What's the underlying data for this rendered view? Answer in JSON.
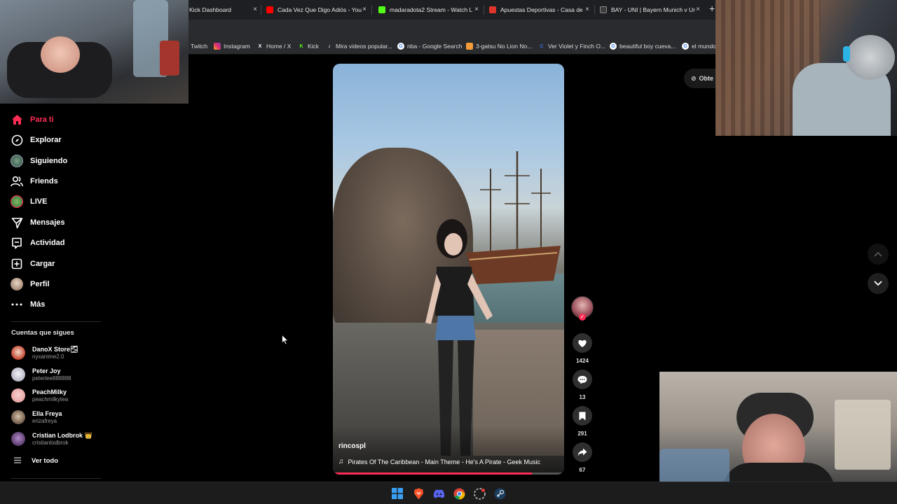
{
  "browser": {
    "tabs": [
      {
        "title": "Kick Dashboard",
        "favicon_color": "#1e1f22"
      },
      {
        "title": "Cada Vez Que Digo Adiós - You",
        "favicon_color": "#ff0000"
      },
      {
        "title": "madaradota2 Stream - Watch L",
        "favicon_color": "#53fc18"
      },
      {
        "title": "Apuestas Deportivas - Casa de",
        "favicon_color": "#e0352b"
      },
      {
        "title": "BAY - UNI | Bayern Munich v Ur",
        "favicon_color": "#3d3d3d"
      }
    ],
    "close_glyph": "×",
    "new_tab_glyph": "+",
    "bookmarks": [
      {
        "label": "Twitch",
        "icon": "twitch-icon",
        "color": "#9146ff",
        "glyph": ""
      },
      {
        "label": "Instagram",
        "icon": "instagram-icon",
        "color": "#e1306c",
        "glyph": ""
      },
      {
        "label": "Home / X",
        "icon": "x-icon",
        "color": "#000000",
        "glyph": "X"
      },
      {
        "label": "Kick",
        "icon": "kick-icon",
        "color": "#53fc18",
        "glyph": "K"
      },
      {
        "label": "Mira videos popular...",
        "icon": "tiktok-icon",
        "color": "#000000",
        "glyph": "♪"
      },
      {
        "label": "nba - Google Search",
        "icon": "google-icon",
        "color": "#ffffff",
        "glyph": "G"
      },
      {
        "label": "3-gatsu No Lion No...",
        "icon": "bookmark-icon",
        "color": "#f29b38",
        "glyph": ""
      },
      {
        "label": "Ver Violet y Finch O...",
        "icon": "link-icon",
        "color": "#3b6de3",
        "glyph": "C"
      },
      {
        "label": "beautiful boy cueva...",
        "icon": "google-icon",
        "color": "#ffffff",
        "glyph": "G"
      },
      {
        "label": "el mundo",
        "icon": "google-icon",
        "color": "#ffffff",
        "glyph": "G"
      }
    ]
  },
  "sidebar": {
    "nav": [
      {
        "label": "Para ti",
        "icon": "home-icon",
        "active": true
      },
      {
        "label": "Explorar",
        "icon": "compass-icon"
      },
      {
        "label": "Siguiendo",
        "icon": "following-avatar-icon"
      },
      {
        "label": "Friends",
        "icon": "friends-icon"
      },
      {
        "label": "LIVE",
        "icon": "live-icon"
      },
      {
        "label": "Mensajes",
        "icon": "send-icon"
      },
      {
        "label": "Actividad",
        "icon": "activity-icon"
      },
      {
        "label": "Cargar",
        "icon": "upload-icon"
      },
      {
        "label": "Perfil",
        "icon": "profile-icon"
      },
      {
        "label": "Más",
        "icon": "more-icon"
      }
    ],
    "following_title": "Cuentas que sigues",
    "following": [
      {
        "name": "DanoX Store🌫",
        "handle": "nyxanime2.0",
        "color": "#c2452f"
      },
      {
        "name": "Peter Joy",
        "handle": "peterlee888888",
        "color": "#d7d7e3"
      },
      {
        "name": "PeachMilky",
        "handle": "peachmilkytea",
        "color": "#e8a6a6"
      },
      {
        "name": "Ella Freya",
        "handle": "erizafreya",
        "color": "#6e5a4a"
      },
      {
        "name": "Cristian Lodbrok 👑",
        "handle": "cristianlodbrok",
        "color": "#5a3c6e"
      }
    ],
    "see_all": "Ver todo"
  },
  "video": {
    "author": "rincospl",
    "music": "Pirates Of The Caribbean - Main Theme - He's A Pirate - Geek Music",
    "progress": 0.86
  },
  "actions": {
    "likes": "1424",
    "comments": "13",
    "saves": "291",
    "shares": "67"
  },
  "get_app_label": "Obte",
  "colors": {
    "accent": "#fe2c55",
    "background": "#000000"
  }
}
